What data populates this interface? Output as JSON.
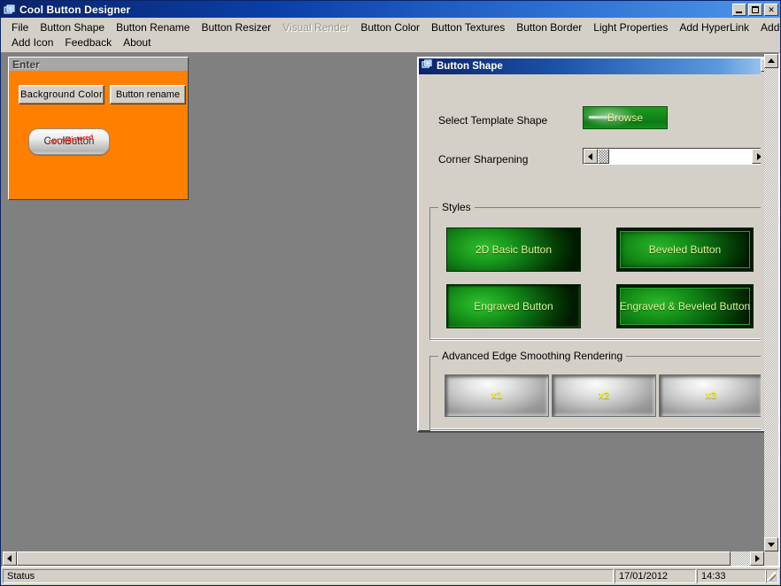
{
  "window": {
    "title": "Cool Button Designer",
    "icon": "app-icon",
    "controls": {
      "minimize": "minimize-button",
      "maximize": "maximize-button",
      "close_label": "✕"
    }
  },
  "menubar": {
    "row1": [
      {
        "label": "File",
        "disabled": false
      },
      {
        "label": "Button Shape",
        "disabled": false
      },
      {
        "label": "Button Rename",
        "disabled": false
      },
      {
        "label": "Button Resizer",
        "disabled": false
      },
      {
        "label": "Visual Render",
        "disabled": true
      },
      {
        "label": "Button Color",
        "disabled": false
      },
      {
        "label": "Button Textures",
        "disabled": false
      },
      {
        "label": "Button Border",
        "disabled": false
      },
      {
        "label": "Light Properties",
        "disabled": false
      },
      {
        "label": "Add HyperLink",
        "disabled": false
      },
      {
        "label": "Add Text",
        "disabled": false
      }
    ],
    "row2": [
      {
        "label": "Add Icon",
        "disabled": false
      },
      {
        "label": "Feedback",
        "disabled": false
      },
      {
        "label": "About",
        "disabled": false
      }
    ]
  },
  "enter_panel": {
    "header": "Enter",
    "background_color": "#ff8000",
    "buttons": {
      "background_color": "Background Color",
      "button_rename": "Button rename"
    },
    "preview": {
      "label": "CoolButton",
      "watermark": "not registered",
      "watermark_color": "#e8201a"
    }
  },
  "shape_window": {
    "title": "Button Shape",
    "icon": "shape-window-icon",
    "fields": {
      "template_shape_label": "Select Template Shape",
      "browse_label": "Browse",
      "corner_sharpening_label": "Corner Sharpening"
    },
    "styles_group": {
      "title": "Styles",
      "buttons": [
        {
          "label": "2D Basic Button",
          "style": "basic"
        },
        {
          "label": "Beveled Button",
          "style": "beveled"
        },
        {
          "label": "Engraved Button",
          "style": "engraved"
        },
        {
          "label": "Engraved & Beveled Button",
          "style": "engraved-beveled"
        }
      ]
    },
    "aes_group": {
      "title": "Advanced Edge Smoothing Rendering",
      "buttons": [
        {
          "label": "x1"
        },
        {
          "label": "x2"
        },
        {
          "label": "x3"
        }
      ]
    }
  },
  "statusbar": {
    "status": "Status",
    "date": "17/01/2012",
    "time": "14:33"
  },
  "colors": {
    "titlebar_blue": "#0a246a",
    "face": "#d4d0c8",
    "mdi_background": "#808080",
    "accent_green": "#13881a",
    "panel_orange": "#ff8000"
  }
}
